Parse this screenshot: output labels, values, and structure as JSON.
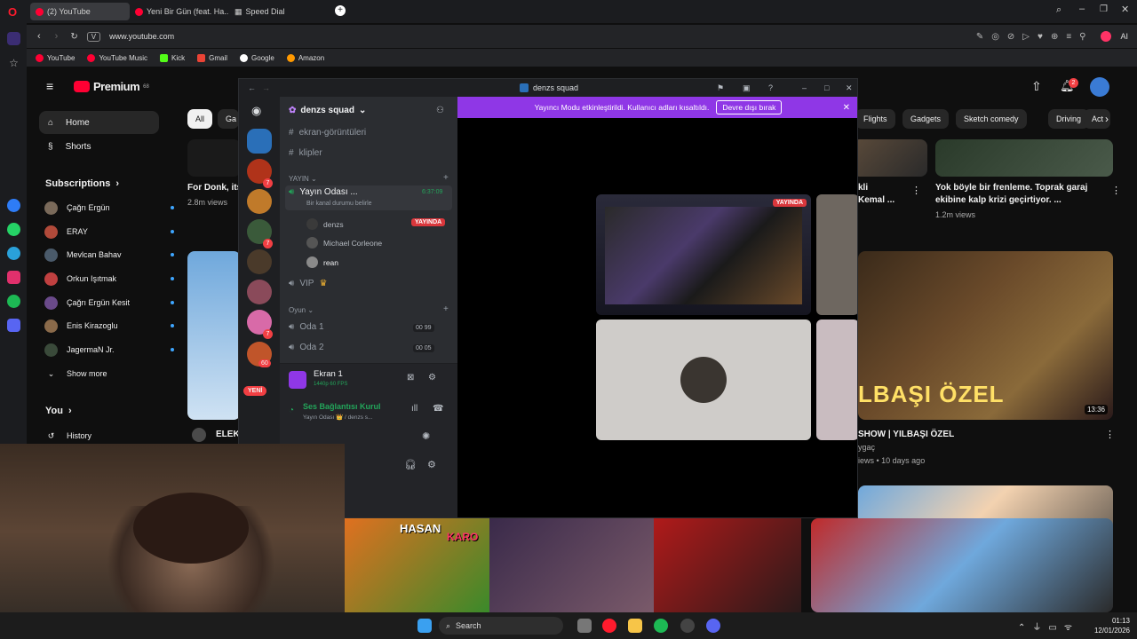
{
  "browser": {
    "tabs": [
      {
        "label": "(2) YouTube",
        "color": "#ff0033"
      },
      {
        "label": "Yeni Bir Gün (feat. Ha...",
        "color": "#ff0033"
      },
      {
        "label": "Speed Dial",
        "color": "#888888"
      }
    ],
    "url": "www.youtube.com",
    "url_prefix": "V",
    "bookmarks": [
      {
        "label": "YouTube",
        "color": "#ff0033"
      },
      {
        "label": "YouTube Music",
        "color": "#ff0033"
      },
      {
        "label": "Kick",
        "color": "#53fc18"
      },
      {
        "label": "Gmail",
        "color": "#ea4335"
      },
      {
        "label": "Google",
        "color": "#4285f4"
      },
      {
        "label": "Amazon",
        "color": "#ff9900"
      }
    ],
    "ai_label": "AI"
  },
  "youtube": {
    "logo": "Premium",
    "logo_sup": "68",
    "nav": [
      {
        "label": "Home"
      },
      {
        "label": "Shorts"
      }
    ],
    "subscriptions_header": "Subscriptions",
    "subscriptions": [
      {
        "name": "Çağrı Ergün",
        "color": "#7a6a5a"
      },
      {
        "name": "ERAY",
        "color": "#b14a3a"
      },
      {
        "name": "Mevlcan Bahav",
        "color": "#4a5a6a"
      },
      {
        "name": "Orkun Işıtmak",
        "color": "#c04040"
      },
      {
        "name": "Çağrı Ergün Kesit",
        "color": "#6a4a8a"
      },
      {
        "name": "Enis Kirazoglu",
        "color": "#8a6a4a"
      },
      {
        "name": "JagermaN Jr.",
        "color": "#3a4a3a"
      }
    ],
    "show_more": "Show more",
    "you_label": "You",
    "history_label": "History",
    "chips": [
      "All",
      "Ga",
      "Flights",
      "Gadgets",
      "Sketch comedy",
      "Driving",
      "Act"
    ],
    "videos": [
      {
        "title": "For Donk, its",
        "meta": "2.8m views"
      },
      {
        "title": "kli",
        "title2": "Kemal ...",
        "meta": ""
      },
      {
        "title": "Yok böyle bir frenleme. Toprak garaj",
        "title2": "ekibine kalp krizi geçirtiyor. ...",
        "meta": "1.2m views"
      },
      {
        "title": "ELEK",
        "meta": ""
      },
      {
        "title": "SHOW | YILBAŞI ÖZEL",
        "channel": "ygaç",
        "meta": "iews • 10 days ago",
        "duration": "13:36",
        "overlay": "LBAŞI ÖZEL"
      }
    ],
    "notif_count": "2"
  },
  "discord": {
    "window_title": "denzs squad",
    "banner_text": "Yayıncı Modu etkinleştirildi. Kullanıcı adları kısaltıldı.",
    "banner_button": "Devre dışı bırak",
    "server_name": "denzs squad",
    "channels_top": [
      "ekran-görüntüleri",
      "klipler"
    ],
    "category_yayin": "YAYIN",
    "voice_room": "Yayın Odası ...",
    "voice_room_time": "6:37:09",
    "voice_room_status": "Bir kanal durumu belirle",
    "members": [
      {
        "name": "denzs",
        "live": "YAYINDA"
      },
      {
        "name": "Michael Corleone",
        "live": ""
      },
      {
        "name": "rean",
        "live": ""
      }
    ],
    "vip_channel": "VIP",
    "category_oyun": "Oyun",
    "oda": [
      {
        "name": "Oda 1",
        "a": "00",
        "b": "99"
      },
      {
        "name": "Oda 2",
        "a": "00",
        "b": "05"
      }
    ],
    "stream_panel": {
      "title": "Ekran 1",
      "sub": "1440p 60 FPS"
    },
    "voice_connected": {
      "title": "Ses Bağlantısı Kurul",
      "sub": "Yayın Odası 👑 / denzs s..."
    },
    "server_badges": [
      "7",
      "7",
      "60",
      "7"
    ],
    "new_label": "YENİ",
    "tile_live": "YAYINDA",
    "colors": {
      "banner": "#8f37e6",
      "live": "#da373c",
      "green": "#23a55a"
    }
  },
  "strip": {
    "labels": [
      "HASAN",
      "KARO"
    ]
  },
  "taskbar": {
    "search": "Search",
    "time": "01:13",
    "date": "12/01/2026"
  }
}
